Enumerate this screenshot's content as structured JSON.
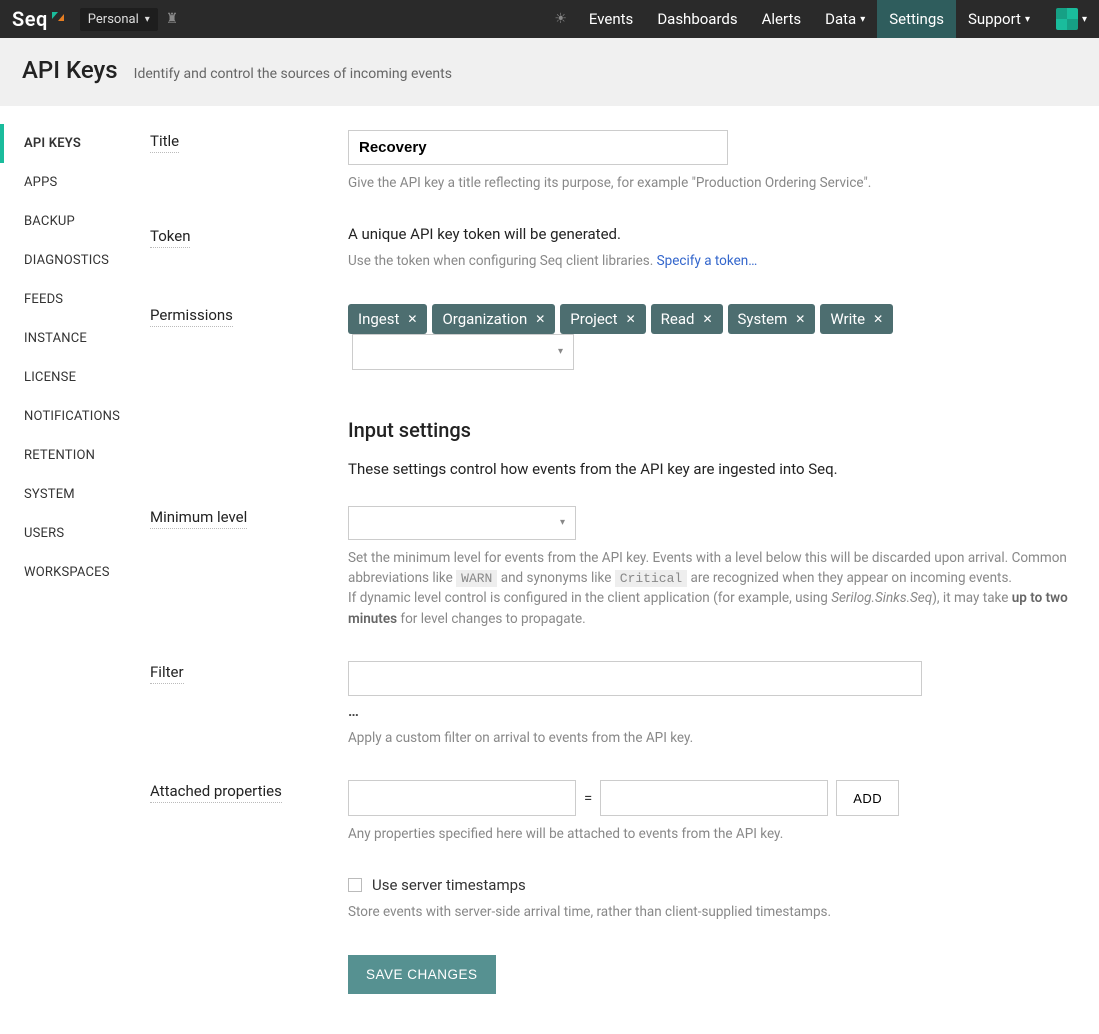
{
  "topnav": {
    "brand": "Seq",
    "workspace": "Personal",
    "items": [
      "Events",
      "Dashboards",
      "Alerts",
      "Data",
      "Settings",
      "Support"
    ],
    "active": "Settings"
  },
  "header": {
    "title": "API Keys",
    "subtitle": "Identify and control the sources of incoming events"
  },
  "sidebar": {
    "items": [
      "API KEYS",
      "APPS",
      "BACKUP",
      "DIAGNOSTICS",
      "FEEDS",
      "INSTANCE",
      "LICENSE",
      "NOTIFICATIONS",
      "RETENTION",
      "SYSTEM",
      "USERS",
      "WORKSPACES"
    ],
    "active": "API KEYS"
  },
  "form": {
    "title_label": "Title",
    "title_value": "Recovery",
    "title_help": "Give the API key a title reflecting its purpose, for example \"Production Ordering Service\".",
    "token_label": "Token",
    "token_msg": "A unique API key token will be generated.",
    "token_help_pre": "Use the token when configuring Seq client libraries. ",
    "token_link": "Specify a token…",
    "perm_label": "Permissions",
    "perm_tags": [
      "Ingest",
      "Organization",
      "Project",
      "Read",
      "System",
      "Write"
    ],
    "input_heading": "Input settings",
    "input_body": "These settings control how events from the API key are ingested into Seq.",
    "level_label": "Minimum level",
    "level_help_1a": "Set the minimum level for events from the API key. Events with a level below this will be discarded upon arrival. Common abbreviations like ",
    "level_code1": "WARN",
    "level_help_1b": " and synonyms like ",
    "level_code2": "Critical",
    "level_help_1c": " are recognized when they appear on incoming events.",
    "level_help_2a": "If dynamic level control is configured in the client application (for example, using ",
    "level_em": "Serilog.Sinks.Seq",
    "level_help_2b": "), it may take ",
    "level_strong": "up to two minutes",
    "level_help_2c": " for level changes to propagate.",
    "filter_label": "Filter",
    "filter_ellipsis": "…",
    "filter_help": "Apply a custom filter on arrival to events from the API key.",
    "props_label": "Attached properties",
    "props_eq": "=",
    "props_add": "ADD",
    "props_help": "Any properties specified here will be attached to events from the API key.",
    "ts_label": "Use server timestamps",
    "ts_help": "Store events with server-side arrival time, rather than client-supplied timestamps.",
    "save": "SAVE CHANGES"
  }
}
